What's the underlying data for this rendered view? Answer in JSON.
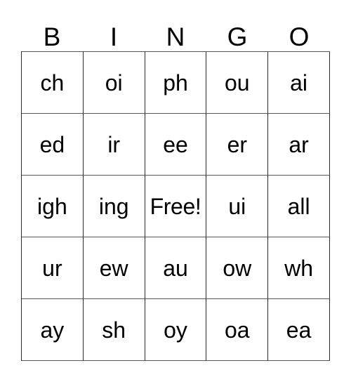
{
  "card": {
    "headers": [
      "B",
      "I",
      "N",
      "G",
      "O"
    ],
    "rows": [
      [
        "ch",
        "oi",
        "ph",
        "ou",
        "ai"
      ],
      [
        "ed",
        "ir",
        "ee",
        "er",
        "ar"
      ],
      [
        "igh",
        "ing",
        "Free!",
        "ui",
        "all"
      ],
      [
        "ur",
        "ew",
        "au",
        "ow",
        "wh"
      ],
      [
        "ay",
        "sh",
        "oy",
        "oa",
        "ea"
      ]
    ],
    "free_space": {
      "row": 2,
      "column": 2,
      "label": "Free!"
    },
    "colors": {
      "background": "#ffffff",
      "text": "#000000",
      "grid_line": "#2b2b2b"
    }
  }
}
